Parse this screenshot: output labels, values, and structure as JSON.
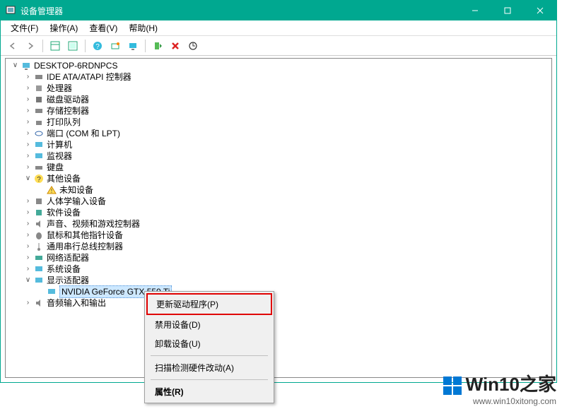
{
  "titlebar": {
    "title": "设备管理器"
  },
  "menubar": {
    "file": "文件(F)",
    "action": "操作(A)",
    "view": "查看(V)",
    "help": "帮助(H)"
  },
  "tree": {
    "root": "DESKTOP-6RDNPCS",
    "ide": "IDE ATA/ATAPI 控制器",
    "cpu": "处理器",
    "disk": "磁盘驱动器",
    "storage": "存储控制器",
    "printq": "打印队列",
    "ports": "端口 (COM 和 LPT)",
    "computer": "计算机",
    "monitor": "监视器",
    "keyboard": "键盘",
    "other": "其他设备",
    "unknown": "未知设备",
    "hid": "人体学输入设备",
    "software": "软件设备",
    "sound": "声音、视频和游戏控制器",
    "mouse": "鼠标和其他指针设备",
    "usb": "通用串行总线控制器",
    "network": "网络适配器",
    "system": "系统设备",
    "display": "显示适配器",
    "gpu": "NVIDIA GeForce GTX 550 Ti",
    "audioio": "音频输入和输出"
  },
  "context_menu": {
    "update": "更新驱动程序(P)",
    "disable": "禁用设备(D)",
    "uninstall": "卸载设备(U)",
    "scan": "扫描检测硬件改动(A)",
    "properties": "属性(R)"
  },
  "watermark": {
    "brand_prefix": "Win10",
    "brand_suffix": "之家",
    "url": "www.win10xitong.com"
  }
}
